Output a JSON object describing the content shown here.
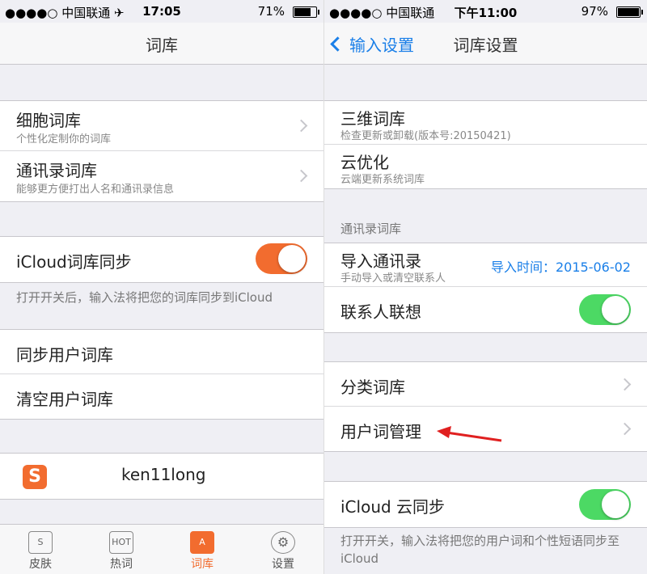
{
  "left": {
    "status": {
      "carrier": "●●●●○ 中国联通 ✈",
      "time": "17:05",
      "battery": "71%",
      "battery_level": 0.71
    },
    "title": "词库",
    "dict_rows": [
      {
        "title": "细胞词库",
        "subtitle": "个性化定制你的词库"
      },
      {
        "title": "通讯录词库",
        "subtitle": "能够更方便打出人名和通讯录信息"
      }
    ],
    "icloud": {
      "label": "iCloud词库同步",
      "on": true,
      "note": "打开开关后，输入法将把您的词库同步到iCloud"
    },
    "actions": [
      "同步用户词库",
      "清空用户词库"
    ],
    "account": {
      "logo": "S",
      "username": "ken11long"
    },
    "tabs": [
      {
        "icon": "S",
        "label": "皮肤"
      },
      {
        "icon": "HOT",
        "label": "热词"
      },
      {
        "icon": "A",
        "label": "词库"
      },
      {
        "icon": "⚙",
        "label": "设置"
      }
    ],
    "active_color": "#f26c2f"
  },
  "right": {
    "status": {
      "carrier": "●●●●○ 中国联通",
      "time": "下午11:00",
      "battery": "97%",
      "battery_level": 0.97
    },
    "back_label": "输入设置",
    "title": "词库设置",
    "rows_top": [
      {
        "title": "三维词库",
        "subtitle": "检查更新或卸载(版本号:20150421)"
      },
      {
        "title": "云优化",
        "subtitle": "云端更新系统词库"
      }
    ],
    "contacts_section": "通讯录词库",
    "import": {
      "title": "导入通讯录",
      "subtitle": "手动导入或清空联系人",
      "detail": "导入时间：2015-06-02"
    },
    "contact_assoc": {
      "label": "联系人联想",
      "on": true
    },
    "menu": [
      "分类词库",
      "用户词管理"
    ],
    "icloud": {
      "label": "iCloud 云同步",
      "on": true,
      "note": "打开开关，输入法将把您的用户词和个性短语同步至iCloud"
    },
    "toggle_color": "#4cd964",
    "link_color": "#1a7fe8"
  }
}
